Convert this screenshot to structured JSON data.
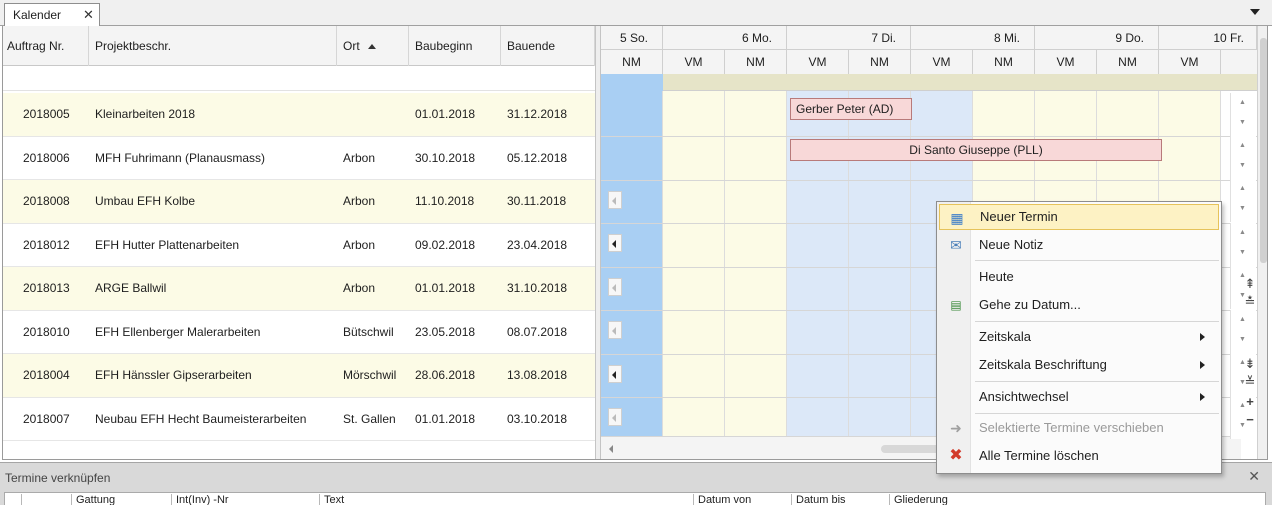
{
  "tab": {
    "title": "Kalender",
    "close": "✕"
  },
  "grid": {
    "columns": [
      {
        "label": "Auftrag Nr."
      },
      {
        "label": "Projektbeschr."
      },
      {
        "label": "Ort"
      },
      {
        "label": "Baubeginn"
      },
      {
        "label": "Bauende"
      }
    ],
    "rows": [
      {
        "nr": "2018005",
        "desc": "Kleinarbeiten 2018",
        "ort": "",
        "beginn": "01.01.2018",
        "ende": "31.12.2018"
      },
      {
        "nr": "2018006",
        "desc": "MFH Fuhrimann (Planausmass)",
        "ort": "Arbon",
        "beginn": "30.10.2018",
        "ende": "05.12.2018"
      },
      {
        "nr": "2018008",
        "desc": "Umbau EFH Kolbe",
        "ort": "Arbon",
        "beginn": "11.10.2018",
        "ende": "30.11.2018"
      },
      {
        "nr": "2018012",
        "desc": "EFH Hutter Plattenarbeiten",
        "ort": "Arbon",
        "beginn": "09.02.2018",
        "ende": "23.04.2018"
      },
      {
        "nr": "2018013",
        "desc": "ARGE Ballwil",
        "ort": "Arbon",
        "beginn": "01.01.2018",
        "ende": "31.10.2018"
      },
      {
        "nr": "2018010",
        "desc": "EFH Ellenberger Malerarbeiten",
        "ort": "Bütschwil",
        "beginn": "23.05.2018",
        "ende": "08.07.2018"
      },
      {
        "nr": "2018004",
        "desc": "EFH Hänssler Gipserarbeiten",
        "ort": "Mörschwil",
        "beginn": "28.06.2018",
        "ende": "13.08.2018"
      },
      {
        "nr": "2018007",
        "desc": "Neubau EFH Hecht Baumeisterarbeiten",
        "ort": "St. Gallen",
        "beginn": "01.01.2018",
        "ende": "03.10.2018"
      }
    ]
  },
  "calendar": {
    "days": [
      "5 So.",
      "6 Mo.",
      "7 Di.",
      "8 Mi.",
      "9 Do.",
      "10 Fr."
    ],
    "halves": [
      "NM",
      "VM",
      "NM",
      "VM",
      "NM",
      "VM",
      "NM",
      "VM",
      "NM",
      "VM"
    ],
    "events": [
      {
        "label": "Gerber Peter (AD)"
      },
      {
        "label": "Di Santo Giuseppe (PLL)"
      }
    ],
    "colors": {
      "sunday": "#a9cff3",
      "weekday": "#fcfbe6",
      "event_bg": "#f8d8d8",
      "today": "#dce8f8"
    }
  },
  "context_menu": {
    "items": [
      {
        "label": "Neuer Termin",
        "icon": "new-appointment-icon",
        "selected": true
      },
      {
        "label": "Neue Notiz",
        "icon": "note-icon"
      },
      {
        "label": "Heute"
      },
      {
        "label": "Gehe zu Datum...",
        "icon": "goto-date-icon"
      },
      {
        "label": "Zeitskala",
        "submenu": true
      },
      {
        "label": "Zeitskala Beschriftung",
        "submenu": true
      },
      {
        "label": "Ansichtwechsel",
        "submenu": true
      },
      {
        "label": "Selektierte Termine verschieben",
        "icon": "move-arrow-icon",
        "disabled": true
      },
      {
        "label": "Alle Termine löschen",
        "icon": "delete-x-icon"
      }
    ]
  },
  "bottom_panel": {
    "title": "Termine verknüpfen",
    "close": "✕",
    "columns": [
      "Gattung",
      "Int(Inv) -Nr",
      "Text",
      "Datum von",
      "Datum bis",
      "Gliederung"
    ]
  }
}
